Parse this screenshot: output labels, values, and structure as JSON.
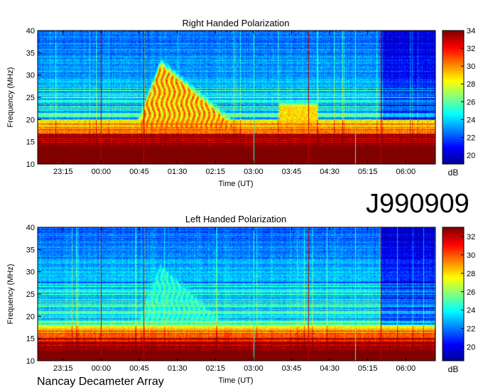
{
  "chart_data": [
    {
      "type": "heatmap",
      "title": "Right Handed Polarization",
      "xlabel": "Time (UT)",
      "ylabel": "Frequency (MHz)",
      "x_ticks": [
        "23:15",
        "00:00",
        "00:45",
        "01:30",
        "02:15",
        "03:00",
        "03:45",
        "04:30",
        "05:15",
        "06:00"
      ],
      "y_ticks": [
        10,
        15,
        20,
        25,
        30,
        35,
        40
      ],
      "ylim": [
        10,
        40
      ],
      "colorbar": {
        "label": "dB",
        "ticks": [
          20,
          22,
          24,
          26,
          28,
          30,
          32,
          34
        ],
        "range": [
          19,
          34
        ]
      },
      "colormap": [
        "#00008f",
        "#0000ff",
        "#0080ff",
        "#00ffff",
        "#80ff80",
        "#ffff00",
        "#ff8000",
        "#ff0000",
        "#800000"
      ],
      "features": {
        "emission_1": {
          "time_start": "00:45",
          "time_end": "02:45",
          "peak_time": "01:10",
          "peak_freq_mhz": 35,
          "level_db": 31
        },
        "emission_2": {
          "time_start": "03:30",
          "time_end": "04:15",
          "peak_freq_mhz": 23,
          "level_db": 30
        },
        "background_high_below_mhz": 20
      }
    },
    {
      "type": "heatmap",
      "title": "Left Handed Polarization",
      "xlabel": "Time (UT)",
      "ylabel": "Frequency (MHz)",
      "x_ticks": [
        "23:15",
        "00:00",
        "00:45",
        "01:30",
        "02:15",
        "03:00",
        "03:45",
        "04:30",
        "05:15",
        "06:00"
      ],
      "y_ticks": [
        10,
        15,
        20,
        25,
        30,
        35,
        40
      ],
      "ylim": [
        10,
        40
      ],
      "colorbar": {
        "label": "dB",
        "ticks": [
          20,
          22,
          24,
          26,
          28,
          30,
          32
        ],
        "range": [
          18.5,
          33
        ]
      },
      "colormap": [
        "#00008f",
        "#0000ff",
        "#0080ff",
        "#00ffff",
        "#80ff80",
        "#ffff00",
        "#ff8000",
        "#ff0000",
        "#800000"
      ],
      "features": {
        "emission_1": {
          "time_start": "00:45",
          "time_end": "02:30",
          "peak_time": "01:10",
          "peak_freq_mhz": 34,
          "level_db": 25
        },
        "background_high_below_mhz": 18
      }
    }
  ],
  "labels": {
    "date_code": "J990909",
    "instrument": "Nancay Decameter Array"
  }
}
